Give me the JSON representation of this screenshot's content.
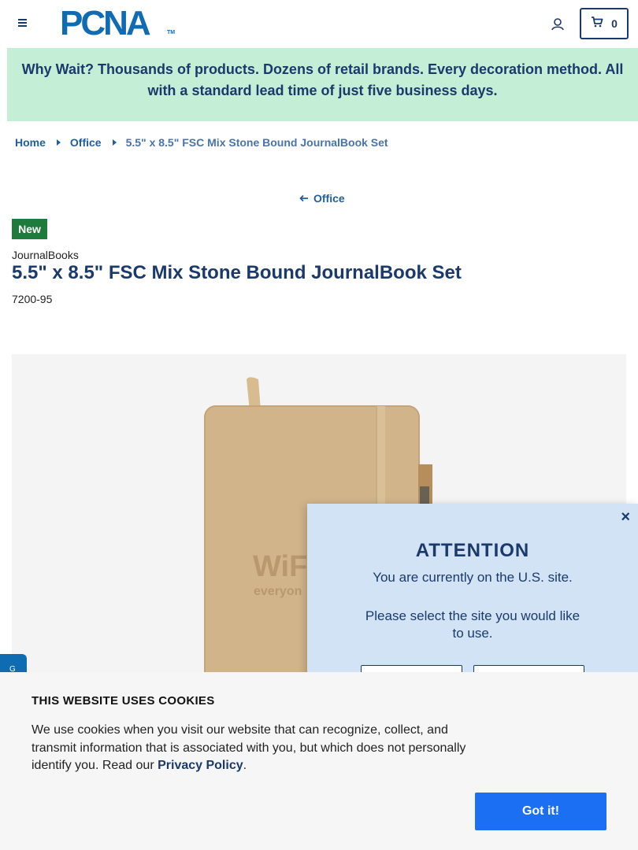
{
  "header": {
    "logo_text": "PCNA",
    "logo_tm": "TM",
    "cart_count": "0",
    "icons": [
      "hamburger-menu-icon",
      "user-account-icon",
      "shopping-cart-icon"
    ]
  },
  "promo": {
    "text": "Why Wait? Thousands of products. Dozens of retail brands. Every decoration method. All with a standard lead time of just five business days."
  },
  "breadcrumb": {
    "home": "Home",
    "category": "Office",
    "current": "5.5\" x 8.5\" FSC Mix Stone Bound JournalBook Set"
  },
  "back_link": "Office",
  "product": {
    "badge": "New",
    "brand": "JournalBooks",
    "title": "5.5\" x 8.5\" FSC Mix Stone Bound JournalBook Set",
    "sku": "7200-95",
    "image_deboss": "WiFi",
    "image_deboss_sub": "everyon"
  },
  "side_tab": "G",
  "modal": {
    "title": "ATTENTION",
    "line1": "You are currently on the U.S. site.",
    "line2": "Please select the site you would like to use.",
    "close": "×"
  },
  "cookie": {
    "title": "THIS WEBSITE USES COOKIES",
    "text": "We use cookies when you visit our website that can recognize, collect, and transmit information that is associated with you, but which does not personally identify you. Read our ",
    "link": "Privacy Policy",
    "suffix": ".",
    "button": "Got it!"
  },
  "colors": {
    "brand_blue": "#0f6bb2",
    "navy": "#1b3a6b",
    "promo_bg": "#c4eed6",
    "badge_green": "#1e7b3c",
    "cookie_button": "#1a6ff2",
    "modal_bg": "#d2e3f6"
  }
}
